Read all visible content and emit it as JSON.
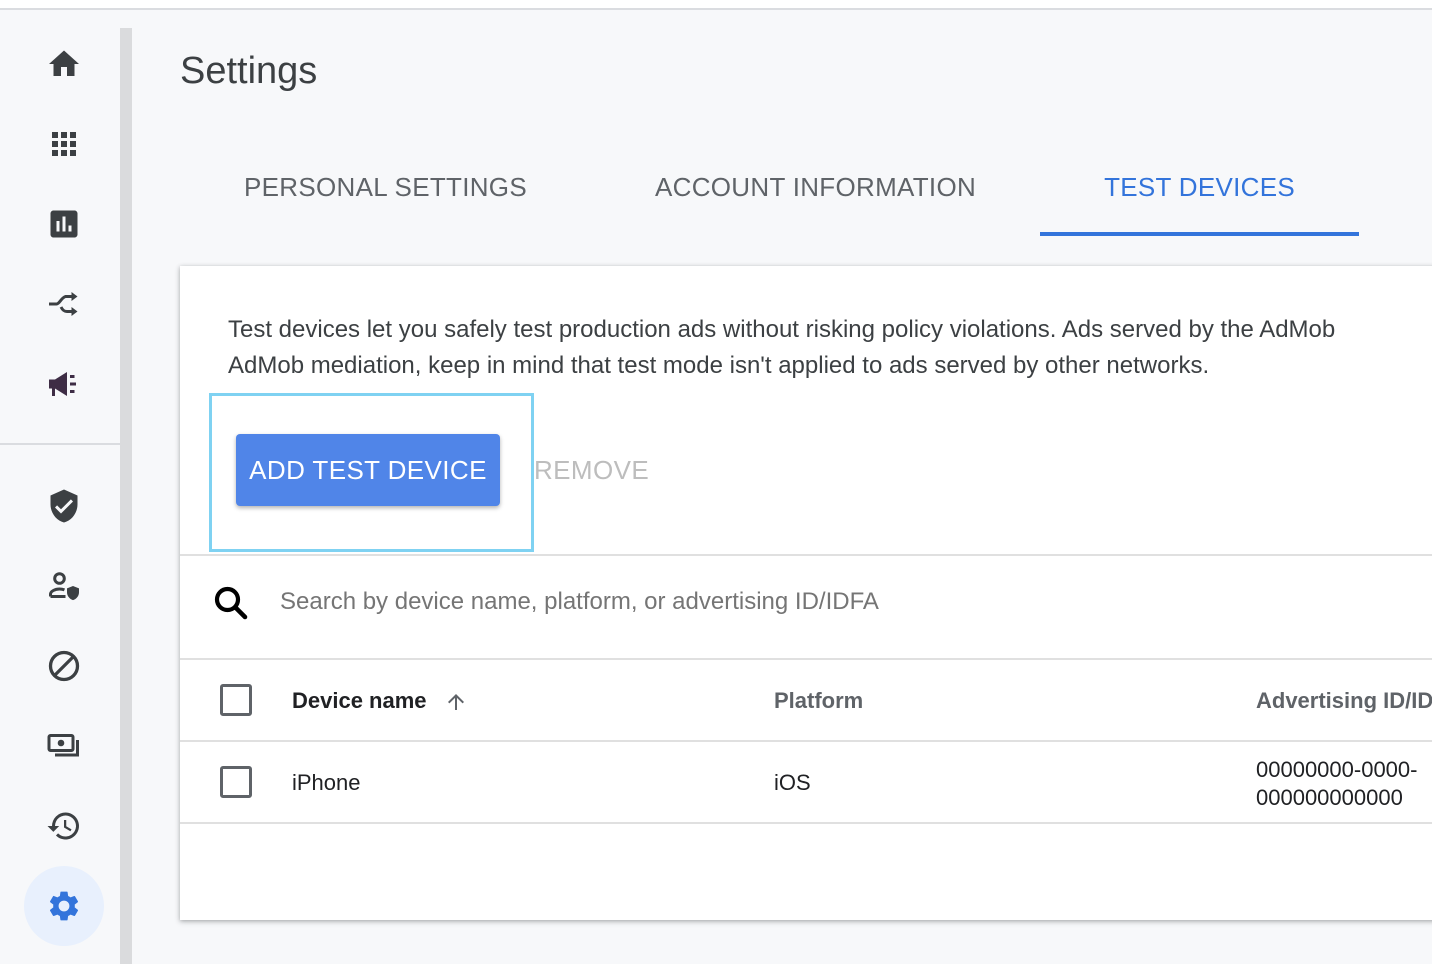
{
  "page": {
    "title": "Settings"
  },
  "sidebar": {
    "items": [
      {
        "name": "home",
        "icon": "home-icon"
      },
      {
        "name": "apps",
        "icon": "apps-grid-icon"
      },
      {
        "name": "reports",
        "icon": "bar-chart-icon"
      },
      {
        "name": "mediation",
        "icon": "shuffle-icon"
      },
      {
        "name": "campaigns",
        "icon": "megaphone-icon"
      },
      {
        "name": "policy-center",
        "icon": "shield-check-icon"
      },
      {
        "name": "privacy-messaging",
        "icon": "person-shield-icon"
      },
      {
        "name": "blocking-controls",
        "icon": "block-icon"
      },
      {
        "name": "payments",
        "icon": "payments-icon"
      },
      {
        "name": "change-history",
        "icon": "history-icon"
      },
      {
        "name": "settings",
        "icon": "gear-icon",
        "active": true
      }
    ]
  },
  "tabs": [
    {
      "label": "PERSONAL SETTINGS",
      "active": false
    },
    {
      "label": "ACCOUNT INFORMATION",
      "active": false
    },
    {
      "label": "TEST DEVICES",
      "active": true
    }
  ],
  "card": {
    "description_line1": "Test devices let you safely test production ads without risking policy violations. Ads served by the AdMob",
    "description_line2": "AdMob mediation, keep in mind that test mode isn't applied to ads served by other networks.",
    "add_button": "ADD TEST DEVICE",
    "remove_button": "REMOVE",
    "search_placeholder": "Search by device name, platform, or advertising ID/IDFA",
    "search_value": ""
  },
  "table": {
    "columns": [
      "Device name",
      "Platform",
      "Advertising ID/ID"
    ],
    "sort": {
      "column": "Device name",
      "direction": "ascending"
    },
    "rows": [
      {
        "device_name": "iPhone",
        "platform": "iOS",
        "advertising_id_line1": "00000000-0000-",
        "advertising_id_line2": "000000000000"
      }
    ]
  },
  "colors": {
    "accent": "#3374db",
    "button": "#5085e8",
    "highlight": "#7fd2f2",
    "active_nav_bg": "#e8f0fd"
  }
}
